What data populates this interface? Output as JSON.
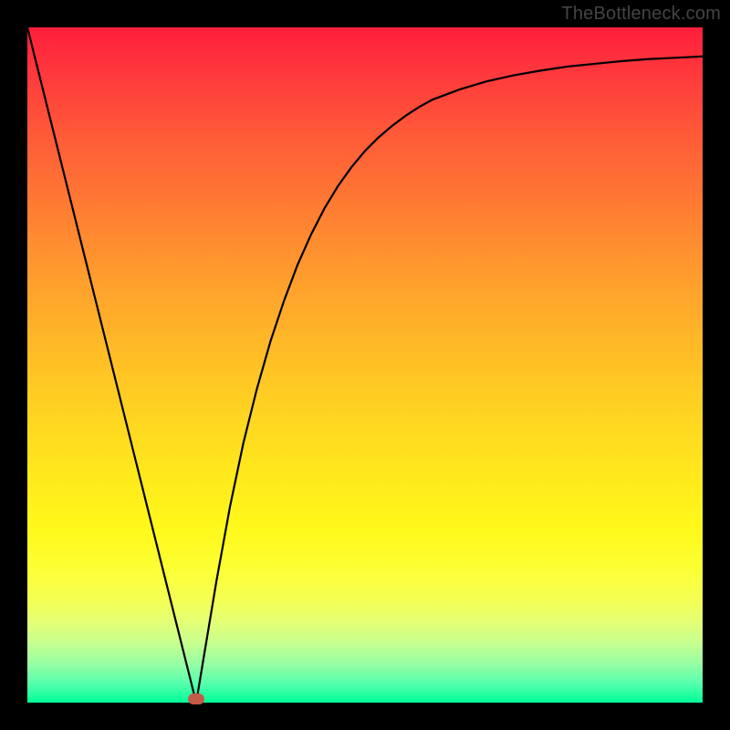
{
  "watermark": "TheBottleneck.com",
  "chart_data": {
    "type": "line",
    "title": "",
    "xlabel": "",
    "ylabel": "",
    "xlim": [
      0,
      1
    ],
    "ylim": [
      0,
      1
    ],
    "x": [
      0.0,
      0.02,
      0.04,
      0.06,
      0.08,
      0.1,
      0.12,
      0.14,
      0.16,
      0.18,
      0.2,
      0.22,
      0.24,
      0.25,
      0.26,
      0.28,
      0.3,
      0.32,
      0.34,
      0.36,
      0.38,
      0.4,
      0.42,
      0.44,
      0.46,
      0.48,
      0.5,
      0.52,
      0.54,
      0.56,
      0.58,
      0.6,
      0.64,
      0.68,
      0.72,
      0.76,
      0.8,
      0.84,
      0.88,
      0.92,
      0.96,
      1.0
    ],
    "y": [
      1.0,
      0.92,
      0.84,
      0.76,
      0.68,
      0.6,
      0.52,
      0.44,
      0.36,
      0.28,
      0.2,
      0.12,
      0.04,
      0.0,
      0.06,
      0.18,
      0.29,
      0.385,
      0.465,
      0.535,
      0.595,
      0.648,
      0.693,
      0.732,
      0.765,
      0.793,
      0.817,
      0.837,
      0.854,
      0.869,
      0.882,
      0.893,
      0.908,
      0.92,
      0.929,
      0.936,
      0.942,
      0.946,
      0.95,
      0.953,
      0.955,
      0.957
    ],
    "valley_marker": {
      "x": 0.25,
      "y": 0.0
    },
    "gradient_stops": [
      {
        "pos": 0.0,
        "color": "#ff1e3c"
      },
      {
        "pos": 0.08,
        "color": "#ff3d3c"
      },
      {
        "pos": 0.16,
        "color": "#ff5a38"
      },
      {
        "pos": 0.26,
        "color": "#ff7a33"
      },
      {
        "pos": 0.36,
        "color": "#ff9a2e"
      },
      {
        "pos": 0.46,
        "color": "#ffb728"
      },
      {
        "pos": 0.56,
        "color": "#ffd122"
      },
      {
        "pos": 0.66,
        "color": "#ffe81d"
      },
      {
        "pos": 0.74,
        "color": "#fff81a"
      },
      {
        "pos": 0.8,
        "color": "#fcff33"
      },
      {
        "pos": 0.85,
        "color": "#f4ff55"
      },
      {
        "pos": 0.88,
        "color": "#e4ff74"
      },
      {
        "pos": 0.91,
        "color": "#c9ff8e"
      },
      {
        "pos": 0.94,
        "color": "#9cffa2"
      },
      {
        "pos": 0.97,
        "color": "#5affad"
      },
      {
        "pos": 1.0,
        "color": "#00ff99"
      }
    ],
    "marker_color": "#c45a4a",
    "curve_color": "#000000"
  }
}
